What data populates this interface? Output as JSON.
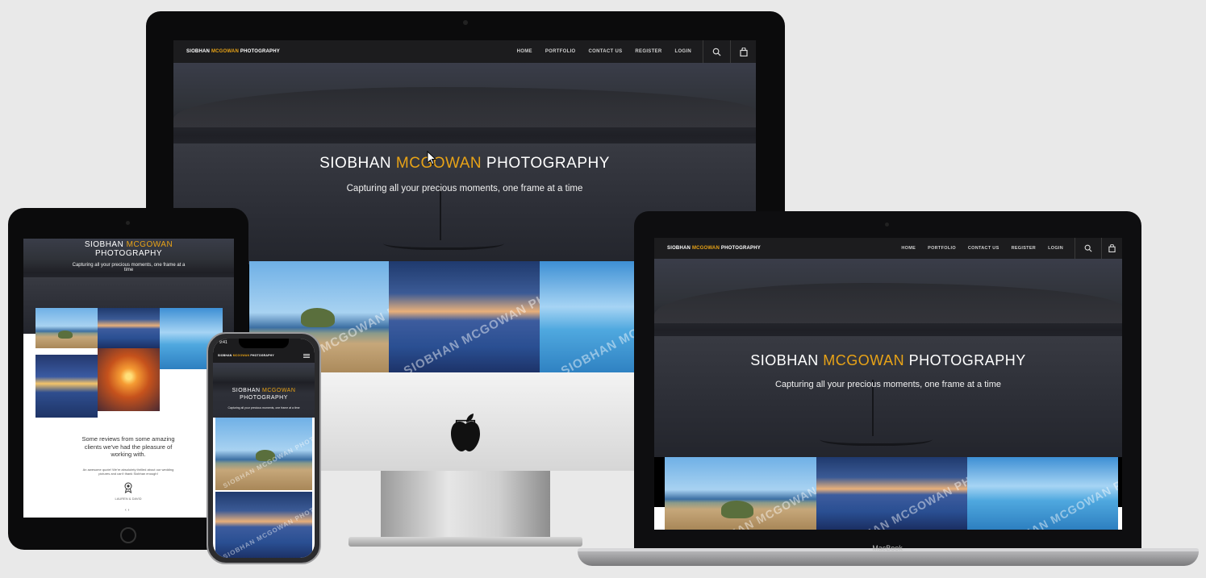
{
  "site": {
    "brand_first": "SIOBHAN ",
    "brand_accent": "MCGOWAN",
    "brand_last": " PHOTOGRAPHY",
    "nav": [
      "HOME",
      "PORTFOLIO",
      "CONTACT US",
      "REGISTER",
      "LOGIN"
    ],
    "hero_first": "SIOBHAN ",
    "hero_accent": "MCGOWAN",
    "hero_last": " PHOTOGRAPHY",
    "tagline": "Capturing all your precious moments, one frame at a time",
    "watermark": "SIOBHAN MCGOWAN PHOTOGRAPHY",
    "accent_color": "#e8a317"
  },
  "icons": {
    "search": "search-icon",
    "bag": "shopping-bag-icon",
    "menu": "hamburger-menu-icon",
    "award": "award-icon"
  },
  "ipad": {
    "reviews_heading": "Some reviews from some amazing clients we've had the pleasure of working with.",
    "reviews_text": "An awesome quote! We're absolutely thrilled about our wedding pictures and can't thank Siobhan enough!",
    "reviewer": "LAUREN & DAVID"
  },
  "iphone": {
    "time": "9:41"
  },
  "devices": {
    "macbook_label": "MacBook"
  }
}
